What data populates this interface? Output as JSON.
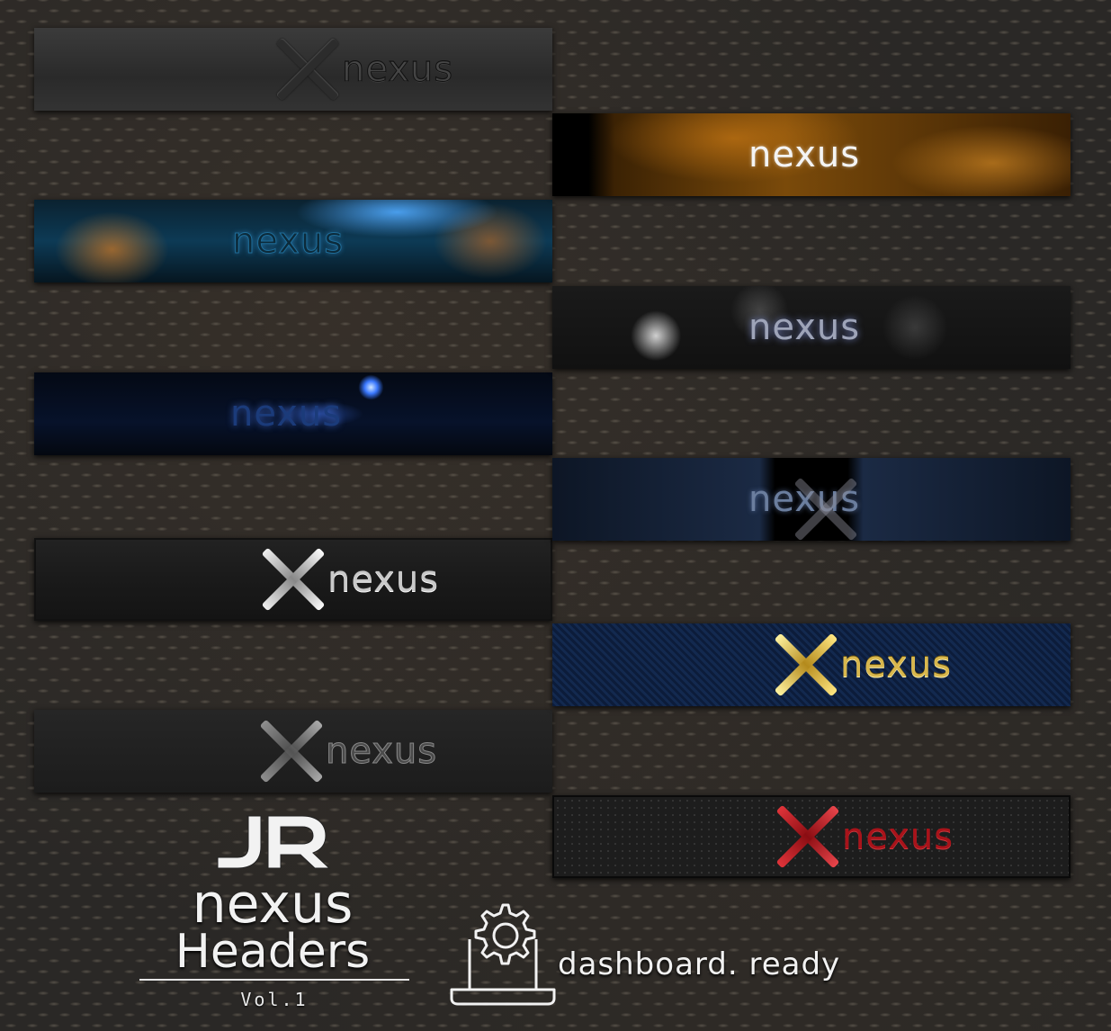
{
  "banners": [
    {
      "text": "nexus"
    },
    {
      "text": "nexus"
    },
    {
      "text": "nexus"
    },
    {
      "text": "nexus"
    },
    {
      "text": "nexus"
    },
    {
      "text": "nexus"
    },
    {
      "text": "nexus"
    },
    {
      "text": "nexus"
    },
    {
      "text": "nexus"
    },
    {
      "text": "nexus"
    }
  ],
  "branding": {
    "monogram": "JR",
    "title": "nexus",
    "subtitle": "Headers",
    "volume": "Vol.1"
  },
  "dashboard": {
    "label": "dashboard. ready",
    "icon": "laptop-gear-icon"
  }
}
